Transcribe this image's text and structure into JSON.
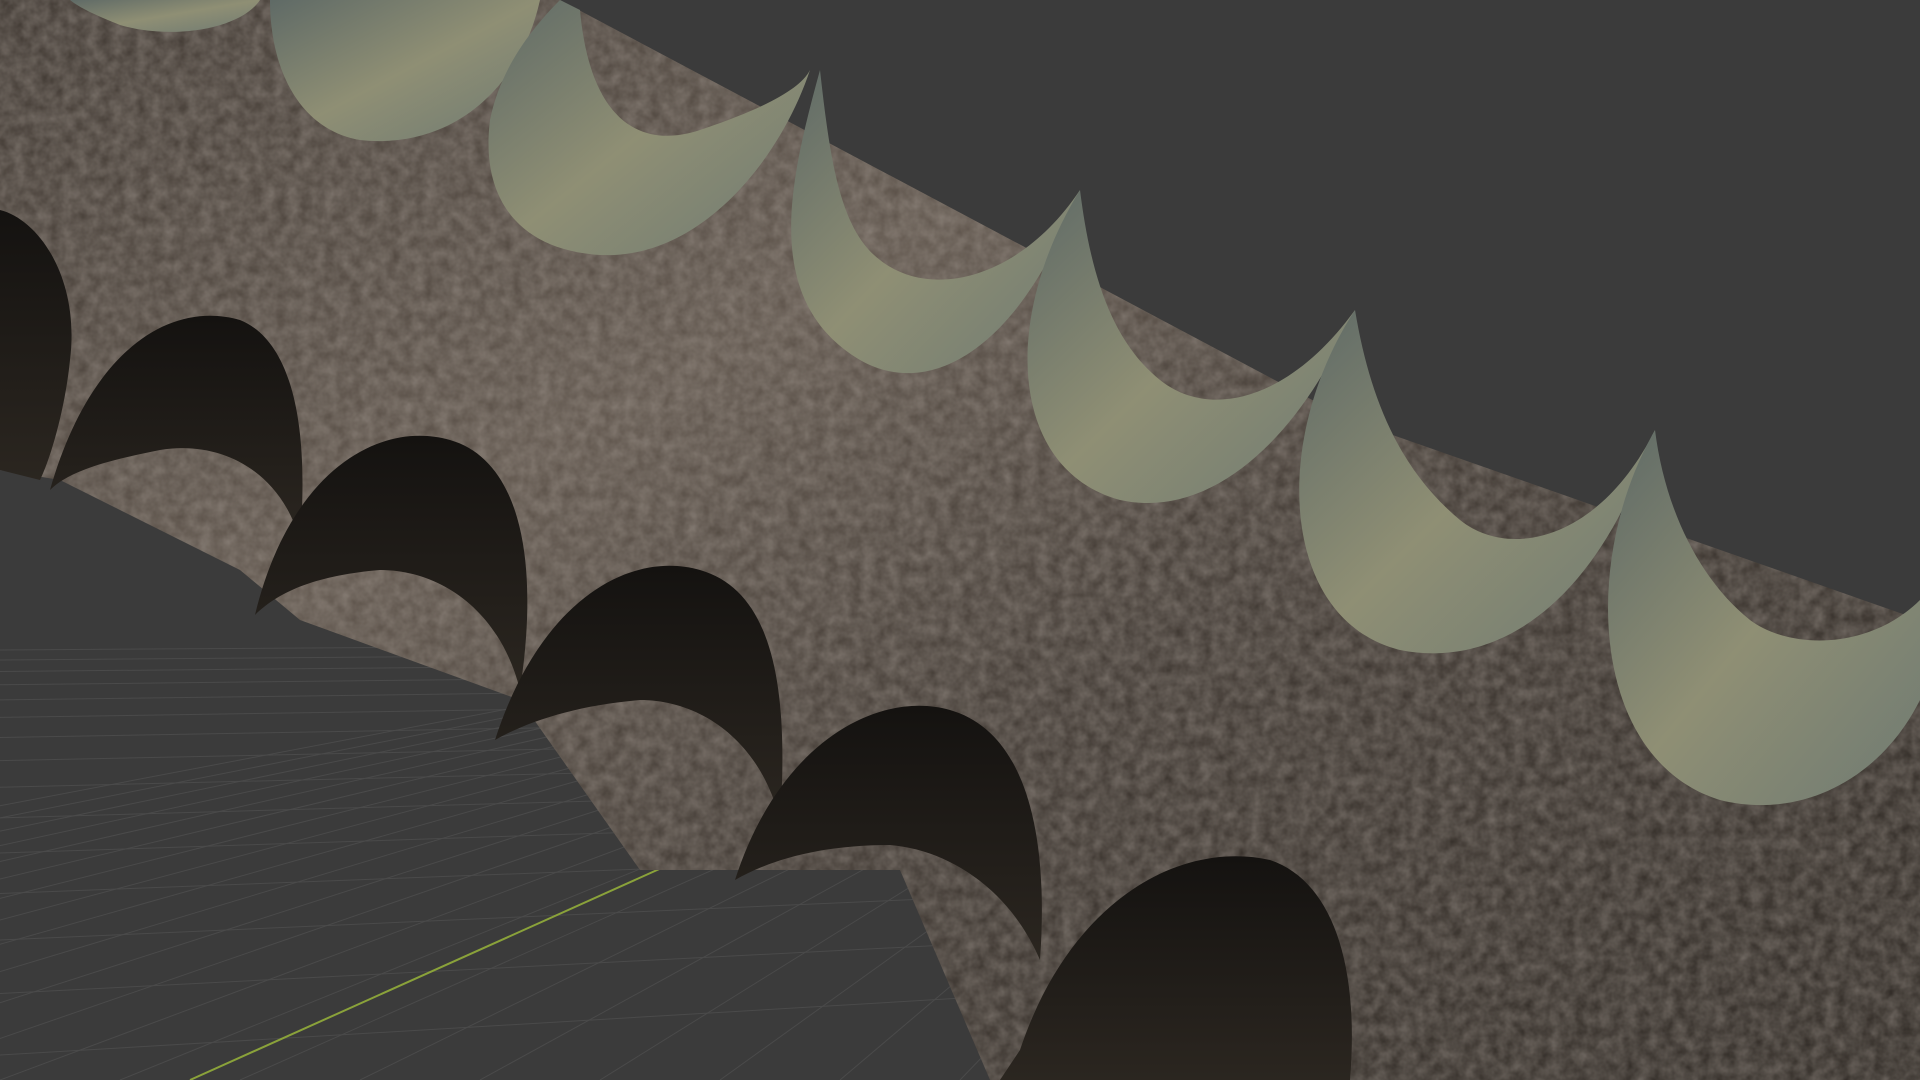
{
  "viewport": {
    "background_color": "#3b3b3b",
    "grid_line_color": "#4a4a4a",
    "x_axis_color": "#8aa23a"
  },
  "model": {
    "body_color": "#2f2a26",
    "body_highlight_color": "#6d6258",
    "top_teeth_color": "#6f7466",
    "top_teeth_highlight_color": "#9a9a80",
    "bottom_teeth_color": "#1a1815"
  }
}
